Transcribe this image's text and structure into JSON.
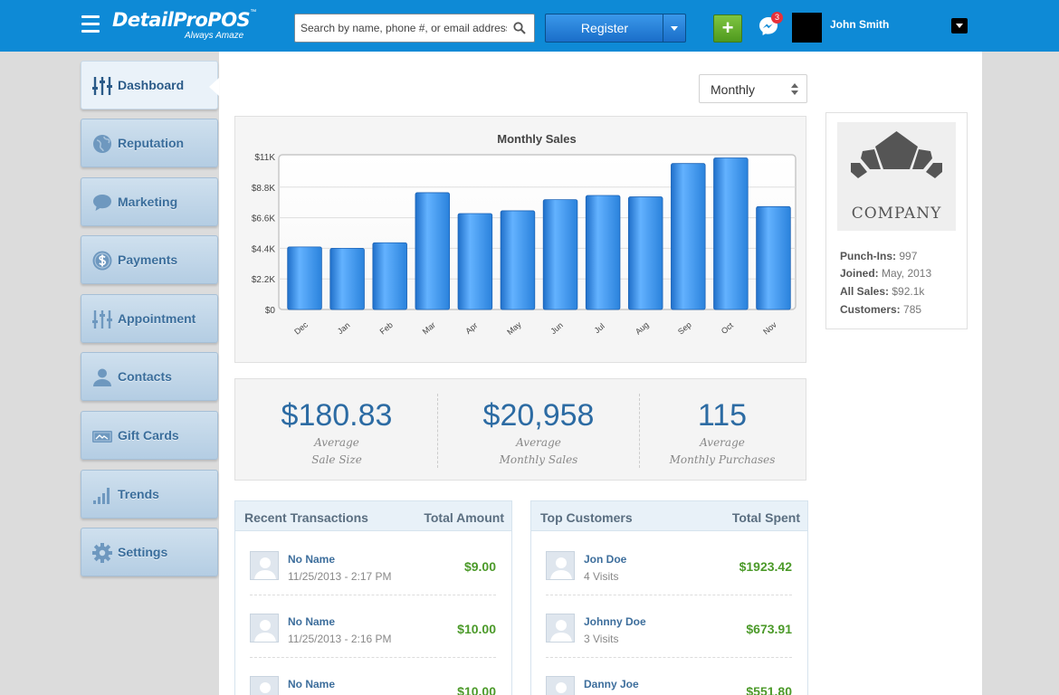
{
  "header": {
    "logo_text": "DetailProPOS",
    "logo_tm": "™",
    "tagline": "Always Amaze",
    "search_placeholder": "Search by name, phone #, or email address",
    "register_label": "Register",
    "add_label": "+",
    "notification_count": "3",
    "user_name": "John Smith",
    "color_primary": "#0e8ad6"
  },
  "sidebar": {
    "items": [
      {
        "label": "Dashboard",
        "icon": "sliders-icon",
        "active": true
      },
      {
        "label": "Reputation",
        "icon": "globe-icon"
      },
      {
        "label": "Marketing",
        "icon": "chat-bubble-icon"
      },
      {
        "label": "Payments",
        "icon": "dollar-coin-icon"
      },
      {
        "label": "Appointment",
        "icon": "sliders-icon"
      },
      {
        "label": "Contacts",
        "icon": "person-icon"
      },
      {
        "label": "Gift Cards",
        "icon": "gift-card-icon"
      },
      {
        "label": "Trends",
        "icon": "bar-chart-icon"
      },
      {
        "label": "Settings",
        "icon": "gear-icon"
      }
    ]
  },
  "period_select": {
    "value": "Monthly"
  },
  "chart_data": {
    "type": "bar",
    "title": "Monthly Sales",
    "categories": [
      "Dec",
      "Jan",
      "Feb",
      "Mar",
      "Apr",
      "May",
      "Jun",
      "Jul",
      "Aug",
      "Sep",
      "Oct",
      "Nov"
    ],
    "values": [
      4500,
      4400,
      4800,
      8400,
      6900,
      7100,
      7900,
      8200,
      8100,
      10500,
      10900,
      7400
    ],
    "y_ticks": [
      "$0",
      "$2.2K",
      "$4.4K",
      "$6.6K",
      "$8.8K",
      "$11K"
    ],
    "ylim": [
      0,
      11000
    ],
    "grid": true,
    "bar_color": "#2e8be6"
  },
  "stats": [
    {
      "value": "$180.83",
      "label1": "Average",
      "label2": "Sale Size"
    },
    {
      "value": "$20,958",
      "label1": "Average",
      "label2": "Monthly Sales"
    },
    {
      "value": "115",
      "label1": "Average",
      "label2": "Monthly Purchases"
    }
  ],
  "transactions": {
    "title": "Recent Transactions",
    "amount_header": "Total Amount",
    "rows": [
      {
        "name": "No Name",
        "sub": "11/25/2013 - 2:17 PM",
        "amount": "$9.00"
      },
      {
        "name": "No Name",
        "sub": "11/25/2013 - 2:16 PM",
        "amount": "$10.00"
      },
      {
        "name": "No Name",
        "sub": "",
        "amount": "$10.00"
      }
    ]
  },
  "customers": {
    "title": "Top Customers",
    "amount_header": "Total Spent",
    "rows": [
      {
        "name": "Jon Doe",
        "sub": "4 Visits",
        "amount": "$1923.42"
      },
      {
        "name": "Johnny Doe",
        "sub": "3 Visits",
        "amount": "$673.91"
      },
      {
        "name": "Danny Joe",
        "sub": "",
        "amount": "$551.80"
      }
    ]
  },
  "company": {
    "name": "COMPANY",
    "stats": [
      {
        "label": "Punch-Ins:",
        "value": "997"
      },
      {
        "label": "Joined:",
        "value": "May, 2013"
      },
      {
        "label": "All Sales:",
        "value": "$92.1k"
      },
      {
        "label": "Customers:",
        "value": "785"
      }
    ]
  }
}
